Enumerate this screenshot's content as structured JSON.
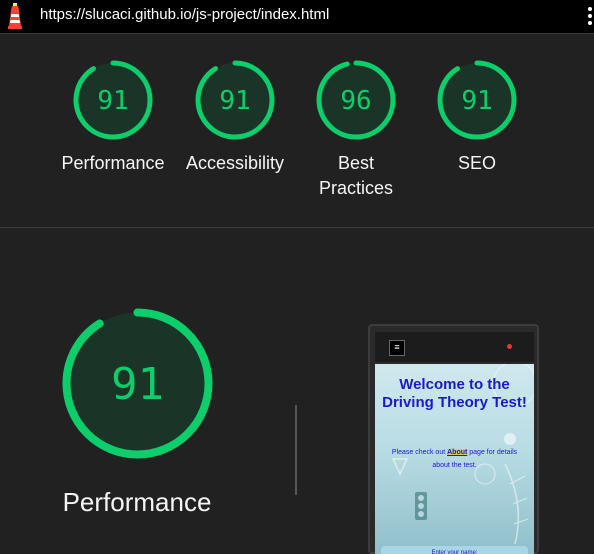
{
  "url_bar": {
    "url": "https://slucaci.github.io/js-project/index.html",
    "logo_icon": "lighthouse-icon",
    "menu_icon": "kebab-menu-icon"
  },
  "summary": {
    "gauges": [
      {
        "score": "91",
        "label": "Performance",
        "fraction": 0.91
      },
      {
        "score": "91",
        "label": "Accessibility",
        "fraction": 0.91
      },
      {
        "score": "96",
        "label": "Best Practices",
        "fraction": 0.96
      },
      {
        "score": "91",
        "label": "SEO",
        "fraction": 0.91
      }
    ]
  },
  "performance": {
    "score": "91",
    "fraction": 0.91,
    "label": "Performance"
  },
  "colors": {
    "pass": "#0cce6b",
    "gauge_fill": "#1a3528",
    "background": "#212121"
  },
  "screenshot": {
    "nav_icon": "hamburger-icon",
    "hamburger_glyph": "≡",
    "title": "Welcome to the Driving Theory Test!",
    "about_prefix": "Please check out ",
    "about_link": "About",
    "about_suffix": " page for details about the test.",
    "name_prompt": "Enter your name:"
  }
}
